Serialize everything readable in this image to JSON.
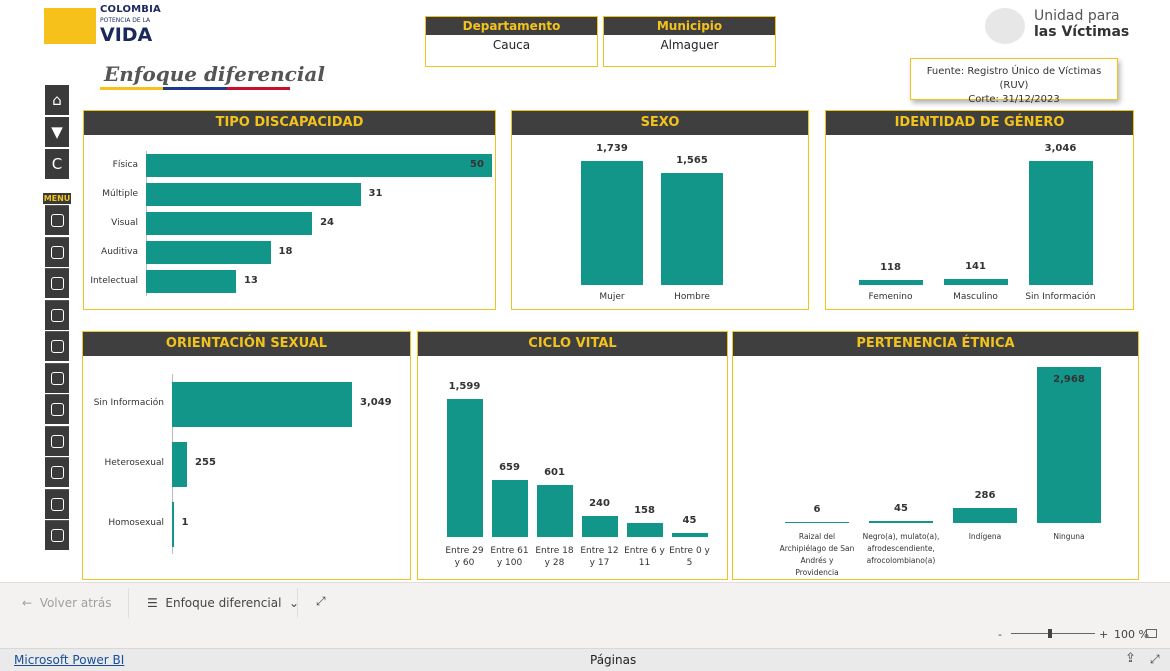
{
  "header": {
    "brand_line1": "COLOMBIA",
    "brand_line2": "POTENCIA DE LA",
    "brand_line3": "VIDA",
    "page_title": "Enfoque diferencial",
    "agency_line1": "Unidad para",
    "agency_line2": "las Víctimas",
    "source_line1": "Fuente: Registro Único de Víctimas (RUV)",
    "source_line2": "Corte: 31/12/2023"
  },
  "filters": {
    "departamento": {
      "label": "Departamento",
      "value": "Cauca"
    },
    "municipio": {
      "label": "Municipio",
      "value": "Almaguer"
    }
  },
  "sidebar": {
    "menu_label": "MENU",
    "top_buttons": [
      {
        "icon": "home-icon",
        "glyph": "⌂"
      },
      {
        "icon": "filter-icon",
        "glyph": "▼"
      },
      {
        "icon": "reset-icon",
        "glyph": "C"
      }
    ],
    "menu_icons": [
      "map-icon",
      "people-icon",
      "ruv-document-icon",
      "family-icon",
      "bar-chart-icon",
      "world-map-icon",
      "report-icon",
      "population-icon",
      "accessibility-icon",
      "table-icon",
      "add-document-icon"
    ]
  },
  "colors": {
    "accent": "#f2c31c",
    "bar": "#13968a",
    "title_bg": "#3f3f3f",
    "flag_yellow": "#f6c11b",
    "flag_blue": "#1b3a8c",
    "flag_red": "#c8102e"
  },
  "chart_data": [
    {
      "type": "bar",
      "orientation": "horizontal",
      "title": "TIPO DISCAPACIDAD",
      "categories": [
        "Física",
        "Múltiple",
        "Visual",
        "Auditiva",
        "Intelectual"
      ],
      "values": [
        50,
        31,
        24,
        18,
        13
      ],
      "value_labels": [
        "50",
        "31",
        "24",
        "18",
        "13"
      ]
    },
    {
      "type": "bar",
      "title": "SEXO",
      "categories": [
        "Mujer",
        "Hombre"
      ],
      "values": [
        1739,
        1565
      ],
      "value_labels": [
        "1,739",
        "1,565"
      ]
    },
    {
      "type": "bar",
      "title": "IDENTIDAD DE GÉNERO",
      "categories": [
        "Femenino",
        "Masculino",
        "Sin Información"
      ],
      "values": [
        118,
        141,
        3046
      ],
      "value_labels": [
        "118",
        "141",
        "3,046"
      ]
    },
    {
      "type": "bar",
      "orientation": "horizontal",
      "title": "ORIENTACIÓN SEXUAL",
      "categories": [
        "Sin Información",
        "Heterosexual",
        "Homosexual"
      ],
      "values": [
        3049,
        255,
        1
      ],
      "value_labels": [
        "3,049",
        "255",
        "1"
      ]
    },
    {
      "type": "bar",
      "title": "CICLO VITAL",
      "categories": [
        [
          "Entre 29",
          "y 60"
        ],
        [
          "Entre 61",
          "y 100"
        ],
        [
          "Entre 18",
          "y 28"
        ],
        [
          "Entre 12",
          "y 17"
        ],
        [
          "Entre 6 y",
          "11"
        ],
        [
          "Entre 0 y",
          "5"
        ]
      ],
      "values": [
        1599,
        659,
        601,
        240,
        158,
        45
      ],
      "value_labels": [
        "1,599",
        "659",
        "601",
        "240",
        "158",
        "45"
      ]
    },
    {
      "type": "bar",
      "title": "PERTENENCIA ÉTNICA",
      "categories": [
        [
          "Raizal del",
          "Archipiélago de San",
          "Andrés y",
          "Providencia"
        ],
        [
          "Negro(a), mulato(a),",
          "afrodescendiente,",
          "afrocolombiano(a)"
        ],
        [
          "Indígena"
        ],
        [
          "Ninguna"
        ]
      ],
      "values": [
        6,
        45,
        286,
        2968
      ],
      "value_labels": [
        "6",
        "45",
        "286",
        "2,968"
      ]
    }
  ],
  "footer": {
    "back_label": "Volver atrás",
    "page_label": "Enfoque diferencial",
    "zoom_label": "100 %",
    "app_link": "Microsoft Power BI",
    "pages_label": "Páginas"
  }
}
